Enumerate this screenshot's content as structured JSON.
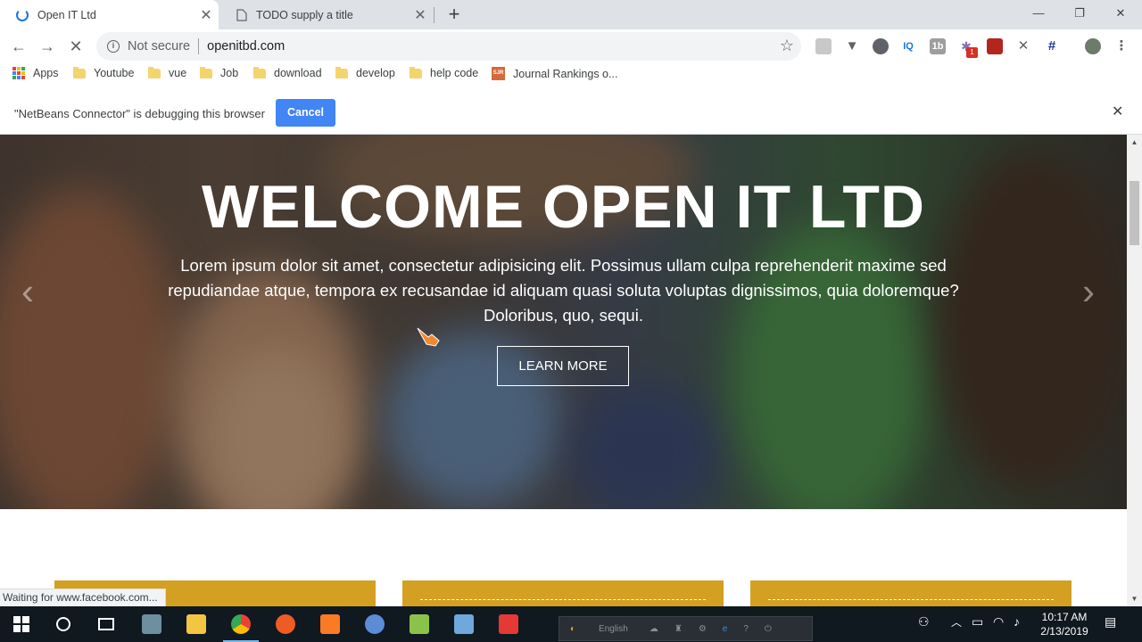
{
  "browser": {
    "tabs": [
      {
        "title": "Open IT Ltd",
        "close": "✕"
      },
      {
        "title": "TODO supply a title",
        "close": "✕"
      }
    ],
    "new_tab": "+",
    "window_controls": {
      "minimize": "—",
      "restore": "❐",
      "close": "✕"
    },
    "nav": {
      "back": "←",
      "forward": "→",
      "stop": "✕"
    },
    "address": {
      "security_label": "Not secure",
      "url": "openitbd.com",
      "star": "☆"
    },
    "extensions": {
      "iq_label": "IQ",
      "onebyte_label": "1b",
      "badge_count": "1"
    }
  },
  "bookmarks": [
    {
      "label": "Apps",
      "icon": "apps-grid-icon"
    },
    {
      "label": "Youtube",
      "icon": "folder-icon"
    },
    {
      "label": "vue",
      "icon": "folder-icon"
    },
    {
      "label": "Job",
      "icon": "folder-icon"
    },
    {
      "label": "download",
      "icon": "folder-icon"
    },
    {
      "label": "develop",
      "icon": "folder-icon"
    },
    {
      "label": "help code",
      "icon": "folder-icon"
    },
    {
      "label": "Journal Rankings o...",
      "icon": "sjr-icon"
    }
  ],
  "sjr_icon_text": "SJR",
  "infobar": {
    "message": "\"NetBeans Connector\" is debugging this browser",
    "cancel_label": "Cancel",
    "close": "✕"
  },
  "hero": {
    "title": "WELCOME OPEN IT LTD",
    "text": "Lorem ipsum dolor sit amet, consectetur adipisicing elit. Possimus ullam culpa reprehenderit maxime sed repudiandae atque, tempora ex recusandae id aliquam quasi soluta voluptas dignissimos, quia doloremque? Doloribus, quo, sequi.",
    "button_label": "LEARN MORE",
    "prev_arrow": "‹",
    "next_arrow": "›"
  },
  "status_text": "Waiting for www.facebook.com...",
  "scrollbar": {
    "up": "▲",
    "down": "▼"
  },
  "taskbar": {
    "language": "English",
    "time": "10:17 AM",
    "date": "2/13/2019"
  },
  "colors": {
    "accent_blue": "#4285f4",
    "card_gold": "#d4a021",
    "taskbar": "#101820"
  }
}
